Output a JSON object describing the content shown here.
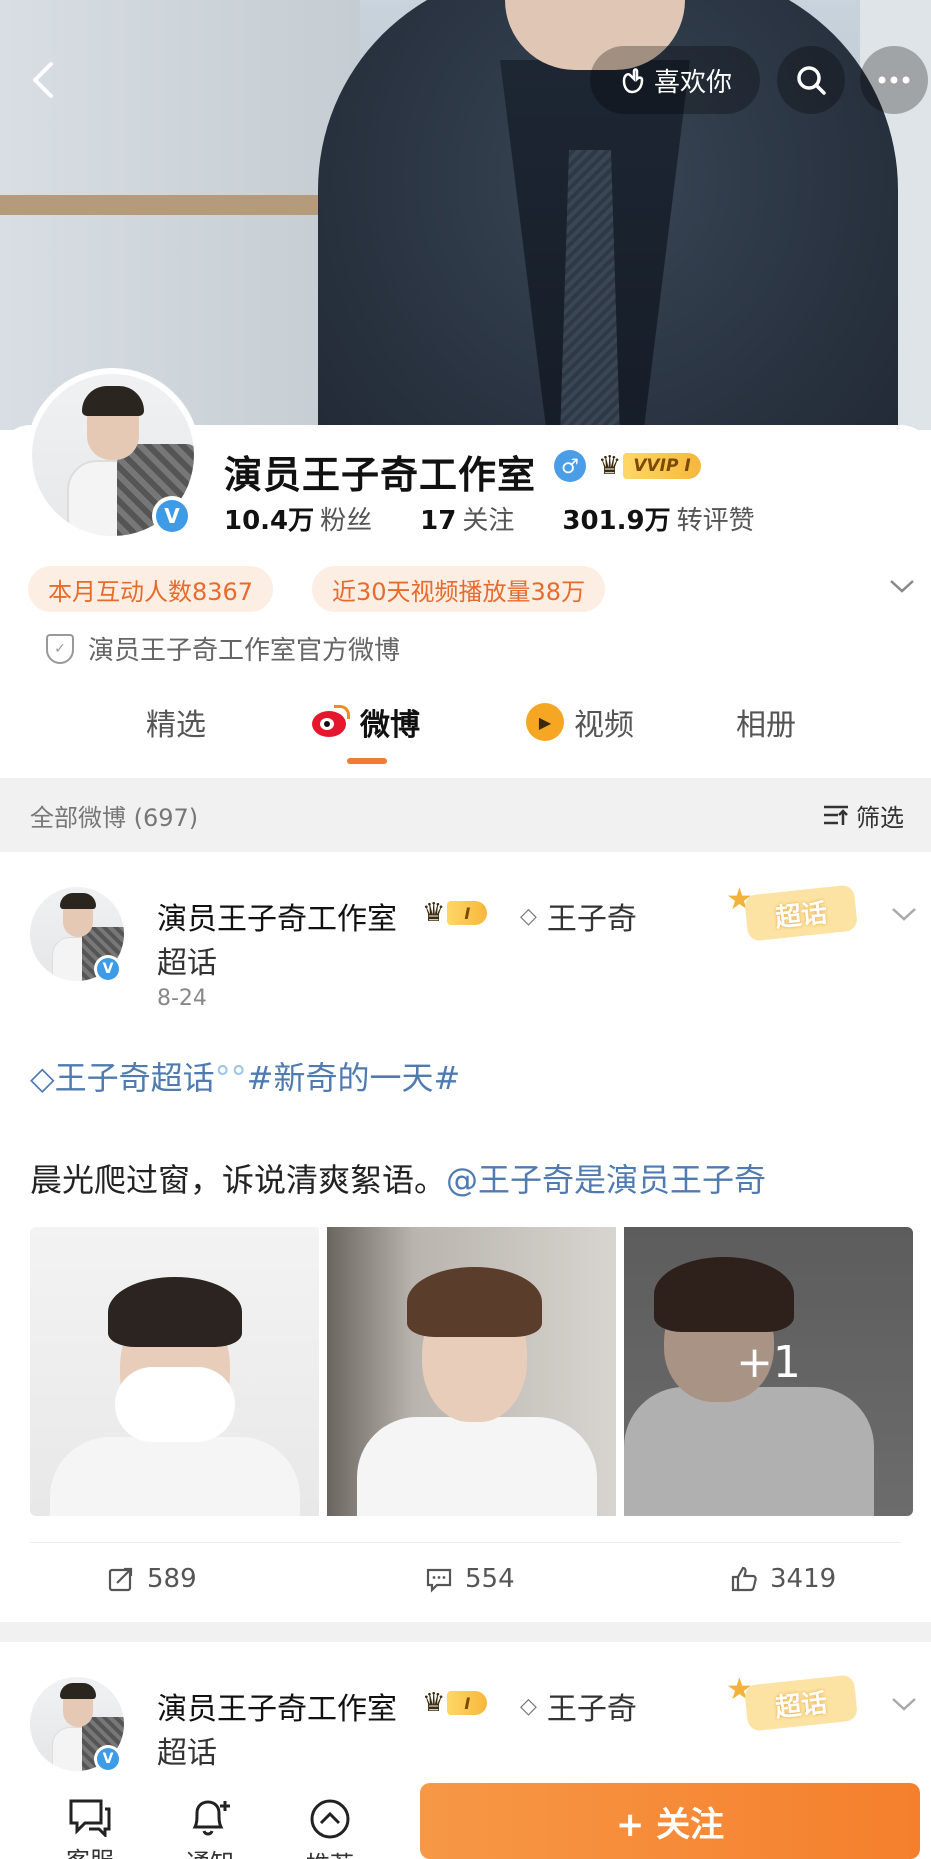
{
  "header": {
    "like_label": "喜欢你"
  },
  "profile": {
    "name": "演员王子奇工作室",
    "vip_tag": "VVIP I",
    "stats": [
      {
        "num": "10.4万",
        "label": "粉丝"
      },
      {
        "num": "17",
        "label": "关注"
      },
      {
        "num": "301.9万",
        "label": "转评赞"
      }
    ],
    "pills": [
      "本月互动人数8367",
      "近30天视频播放量38万"
    ],
    "official_desc": "演员王子奇工作室官方微博"
  },
  "tabs": [
    {
      "label": "精选"
    },
    {
      "label": "微博"
    },
    {
      "label": "视频"
    },
    {
      "label": "相册"
    }
  ],
  "filter_bar": {
    "all_weibo": "全部微博 (697)",
    "filter_label": "筛选"
  },
  "post": {
    "author": "演员王子奇工作室",
    "crown_tag": "I",
    "topic_part1": "王子奇",
    "topic_part2": "超话",
    "badge": "超话",
    "date": "8-24",
    "topic_link": "王子奇超话",
    "hashtag": "#新奇的一天#",
    "text": "晨光爬过窗，诉说清爽絮语。",
    "mention": "@王子奇是演员王子奇",
    "extra_photos": "+1",
    "reposts": "589",
    "comments": "554",
    "likes": "3419"
  },
  "post2": {
    "author": "演员王子奇工作室",
    "crown_tag": "I",
    "topic_part1": "王子奇",
    "topic_part2": "超话",
    "badge": "超话"
  },
  "bottom_bar": {
    "items": [
      {
        "label": "客服"
      },
      {
        "label": "通知"
      },
      {
        "label": "推荐"
      }
    ],
    "follow_label": "+ 关注"
  },
  "colors": {
    "accent": "#f07b33",
    "pill_bg": "#fdeee3",
    "link": "#4f7bb0",
    "verified": "#3e9be8"
  }
}
